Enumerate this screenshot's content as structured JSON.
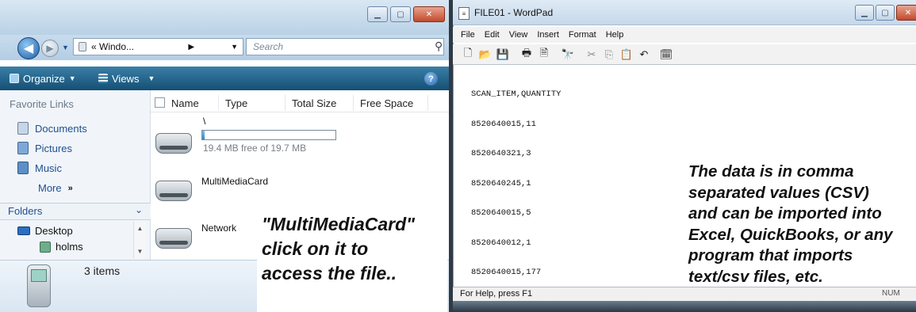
{
  "explorer": {
    "address": "« Windo...",
    "search_placeholder": "Search",
    "toolbar": {
      "organize": "Organize",
      "views": "Views"
    },
    "favorite_links_heading": "Favorite Links",
    "favorite_links": [
      "Documents",
      "Pictures",
      "Music"
    ],
    "more_label": "More",
    "folders_heading": "Folders",
    "tree": [
      "Desktop",
      "holms"
    ],
    "columns": [
      "Name",
      "Type",
      "Total Size",
      "Free Space"
    ],
    "items": [
      {
        "name": "\\",
        "capacity_text": "19.4 MB free of 19.7 MB",
        "used_fraction": 0.015
      },
      {
        "name": "MultiMediaCard"
      },
      {
        "name": "Network"
      }
    ],
    "status": "3 items",
    "caption_lines": [
      "\"MultiMediaCard\"",
      "click on it to",
      "access the file.."
    ]
  },
  "wordpad": {
    "title": "FILE01 - WordPad",
    "menu": [
      "File",
      "Edit",
      "View",
      "Insert",
      "Format",
      "Help"
    ],
    "document_lines": [
      "SCAN_ITEM,QUANTITY",
      "8520640015,11",
      "8520640321,3",
      "8520640245,1",
      "8520640015,5",
      "8520640012,1",
      "8520640015,177"
    ],
    "caption_lines": [
      "The data is in comma",
      "separated values (CSV)",
      "and can be imported into",
      "Excel, QuickBooks, or any",
      "program that imports",
      "text/csv files, etc."
    ],
    "status_help": "For Help, press F1",
    "status_num": "NUM"
  }
}
